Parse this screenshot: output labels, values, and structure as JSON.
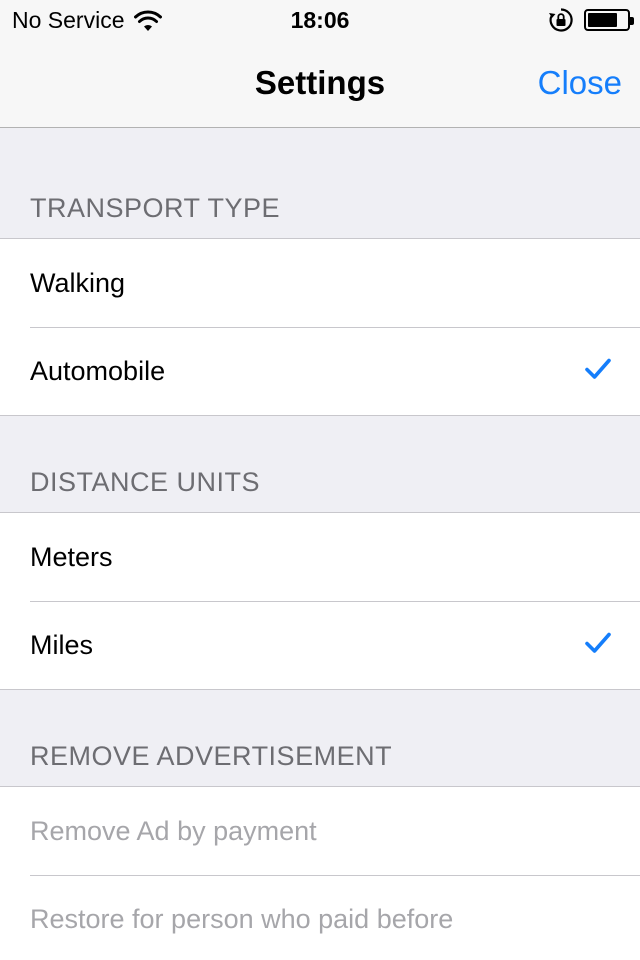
{
  "status_bar": {
    "carrier": "No Service",
    "time": "18:06",
    "battery_level": 0.75
  },
  "nav": {
    "title": "Settings",
    "close_label": "Close"
  },
  "colors": {
    "accent": "#157efb",
    "background": "#efeff4",
    "header_text": "#6d6d72",
    "disabled_text": "#a6a6aa"
  },
  "sections": [
    {
      "header": "TRANSPORT TYPE",
      "rows": [
        {
          "label": "Walking",
          "checked": false
        },
        {
          "label": "Automobile",
          "checked": true,
          "icon": "checkmark-icon"
        }
      ]
    },
    {
      "header": "DISTANCE UNITS",
      "rows": [
        {
          "label": "Meters",
          "checked": false
        },
        {
          "label": "Miles",
          "checked": true,
          "icon": "checkmark-icon"
        }
      ]
    },
    {
      "header": "REMOVE ADVERTISEMENT",
      "rows": [
        {
          "label": "Remove Ad by payment",
          "disabled": true
        },
        {
          "label": "Restore for person who paid before",
          "disabled": true
        }
      ]
    }
  ]
}
